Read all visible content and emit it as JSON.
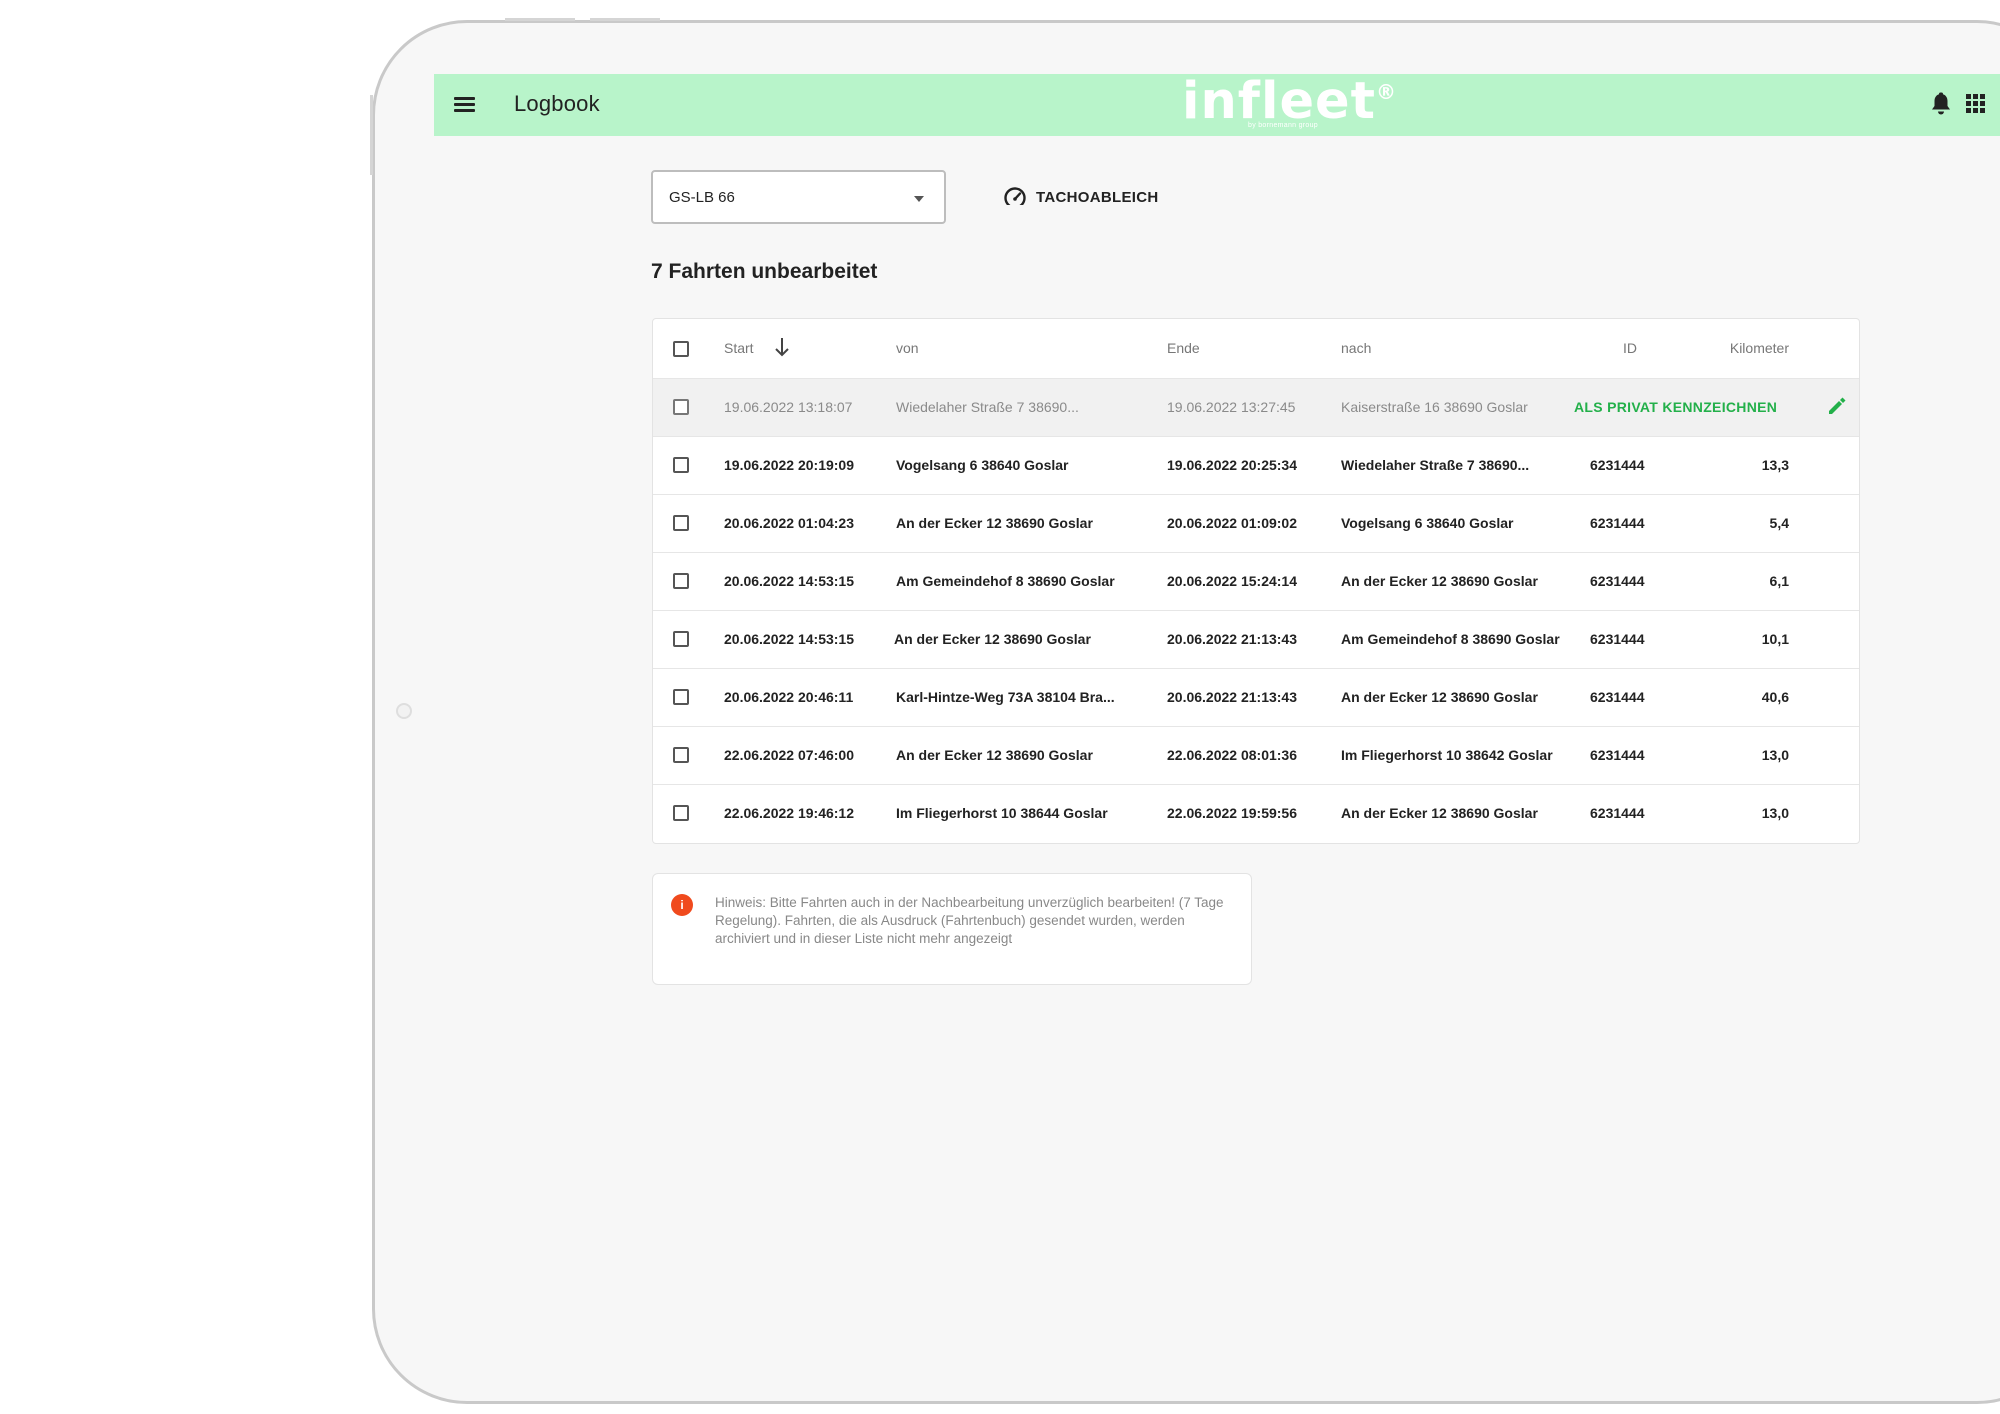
{
  "app": {
    "title": "Logbook",
    "logo": "infleet",
    "logo_mark": "®",
    "logo_sub": "by bornemann group"
  },
  "colors": {
    "appbar": "#b8f4ca",
    "accent_green": "#23b04a",
    "info_red": "#f04a1d"
  },
  "icons": {
    "menu": "hamburger-icon",
    "bell": "bell-icon",
    "apps": "grid-icon",
    "tacho": "speedometer-icon",
    "sort": "arrow-down-icon",
    "edit": "pencil-icon",
    "info": "info-icon"
  },
  "vehicle_select": {
    "value": "GS-LB 66"
  },
  "tacho_button": {
    "label": "TACHOABLEICH"
  },
  "heading": "7 Fahrten unbearbeitet",
  "table": {
    "headers": {
      "start": "Start",
      "von": "von",
      "ende": "Ende",
      "nach": "nach",
      "id": "ID",
      "km": "Kilometer"
    },
    "rows": [
      {
        "start": "19.06.2022 13:18:07",
        "von": "Wiedelaher Straße 7 38690...",
        "ende": "19.06.2022 13:27:45",
        "nach": "Kaiserstraße 16 38690 Goslar",
        "action": "ALS PRIVAT KENNZEICHNEN"
      },
      {
        "start": "19.06.2022 20:19:09",
        "von": "Vogelsang 6 38640 Goslar",
        "ende": "19.06.2022 20:25:34",
        "nach": "Wiedelaher Straße 7 38690...",
        "id": "6231444",
        "km": "13,3"
      },
      {
        "start": "20.06.2022 01:04:23",
        "von": "An der Ecker 12 38690 Goslar",
        "ende": "20.06.2022 01:09:02",
        "nach": "Vogelsang 6 38640 Goslar",
        "id": "6231444",
        "km": "5,4"
      },
      {
        "start": "20.06.2022 14:53:15",
        "von": "Am Gemeindehof 8 38690 Goslar",
        "ende": "20.06.2022 15:24:14",
        "nach": "An der Ecker 12 38690 Goslar",
        "id": "6231444",
        "km": "6,1"
      },
      {
        "start": "20.06.2022 14:53:15",
        "von": "An der Ecker 12 38690 Goslar",
        "ende": "20.06.2022 21:13:43",
        "nach": "Am Gemeindehof 8 38690 Goslar",
        "id": "6231444",
        "km": "10,1"
      },
      {
        "start": "20.06.2022 20:46:11",
        "von": "Karl-Hintze-Weg 73A 38104 Bra...",
        "ende": "20.06.2022 21:13:43",
        "nach": "An der Ecker 12 38690 Goslar",
        "id": "6231444",
        "km": "40,6"
      },
      {
        "start": "22.06.2022 07:46:00",
        "von": "An der Ecker 12 38690 Goslar",
        "ende": "22.06.2022 08:01:36",
        "nach": "Im Fliegerhorst 10 38642 Goslar",
        "id": "6231444",
        "km": "13,0"
      },
      {
        "start": "22.06.2022 19:46:12",
        "von": "Im Fliegerhorst 10 38644 Goslar",
        "ende": "22.06.2022 19:59:56",
        "nach": "An der Ecker 12 38690 Goslar",
        "id": "6231444",
        "km": "13,0"
      }
    ]
  },
  "notice": {
    "icon_glyph": "i",
    "text": "Hinweis: Bitte Fahrten auch in der Nachbearbeitung unverzüglich bearbeiten! (7 Tage Regelung). Fahrten, die als Ausdruck (Fahrtenbuch) gesendet wurden, werden archiviert und in dieser Liste nicht mehr angezeigt"
  }
}
